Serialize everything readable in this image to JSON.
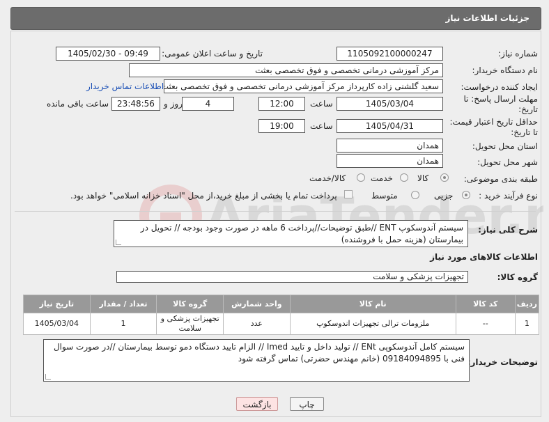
{
  "header": {
    "title": "جزئیات اطلاعات نیاز"
  },
  "fields": {
    "need_number_label": "شماره نیاز:",
    "need_number": "1105092100000247",
    "announce_label": "تاریخ و ساعت اعلان عمومی:",
    "announce_value": "1405/02/30 - 09:49",
    "buyer_org_label": "نام دستگاه خریدار:",
    "buyer_org": "مرکز آموزشی درمانی تخصصی و فوق تخصصی بعثت",
    "creator_label": "ایجاد کننده درخواست:",
    "creator": "سعید گلشنی زاده کارپرداز مرکز آموزشی درمانی تخصصی و فوق تخصصی بعثت",
    "contact_link": "اطلاعات تماس خریدار",
    "reply_deadline_label_1": "مهلت ارسال پاسخ: تا",
    "reply_deadline_label_2": "تاریخ:",
    "reply_date": "1405/03/04",
    "time_label": "ساعت",
    "reply_time": "12:00",
    "days_value": "4",
    "days_label": "روز و",
    "remaining_time": "23:48:56",
    "remaining_label": "ساعت باقی مانده",
    "price_validity_label_1": "حداقل تاریخ اعتبار قیمت:",
    "price_validity_label_2": "تا تاریخ:",
    "price_date": "1405/04/31",
    "price_time": "19:00",
    "province_label": "استان محل تحویل:",
    "province": "همدان",
    "city_label": "شهر محل تحویل:",
    "city": "همدان",
    "category_label": "طبقه بندی موضوعی:",
    "category_options": [
      "کالا",
      "خدمت",
      "کالا/خدمت"
    ],
    "category_selected": "کالا",
    "process_label": "نوع فرآیند خرید :",
    "process_options": [
      "جزیی",
      "متوسط"
    ],
    "process_selected": "جزیی",
    "payment_note": "پرداخت تمام یا بخشی از مبلغ خرید،از محل \"اسناد خزانه اسلامی\" خواهد بود."
  },
  "description": {
    "label": "شرح کلی نیاز:",
    "text": "سیستم آندوسکوپ ENT //طبق توضیحات//پرداخت 6 ماهه در صورت وجود بودجه // تحویل در بیمارستان (هزینه حمل با فروشنده)"
  },
  "goods": {
    "section_title": "اطلاعات کالاهای مورد نیاز",
    "group_label": "گروه کالا:",
    "group_value": "تجهیزات پزشکی و سلامت",
    "columns": [
      "ردیف",
      "کد کالا",
      "نام کالا",
      "واحد شمارش",
      "گروه کالا",
      "تعداد / مقدار",
      "تاریخ نیاز"
    ],
    "rows": [
      [
        "1",
        "--",
        "ملزومات ترالی تجهیزات اندوسکوپ",
        "عدد",
        "تجهیزات پزشکی و سلامت",
        "1",
        "1405/03/04"
      ]
    ]
  },
  "buyer_notes": {
    "label": "توضیحات خریدار:",
    "text": "سیستم کامل آندوسکوپی ENt  //  تولید داخل  و تایید Imed //  الزام تایید دستگاه دمو توسط بیمارستان //در صورت سوال فنی با 09184094895 (خانم مهندس حضرتی) تماس گرفته شود"
  },
  "buttons": {
    "print": "چاپ",
    "back": "بازگشت"
  },
  "watermark": "AriaTender.net"
}
